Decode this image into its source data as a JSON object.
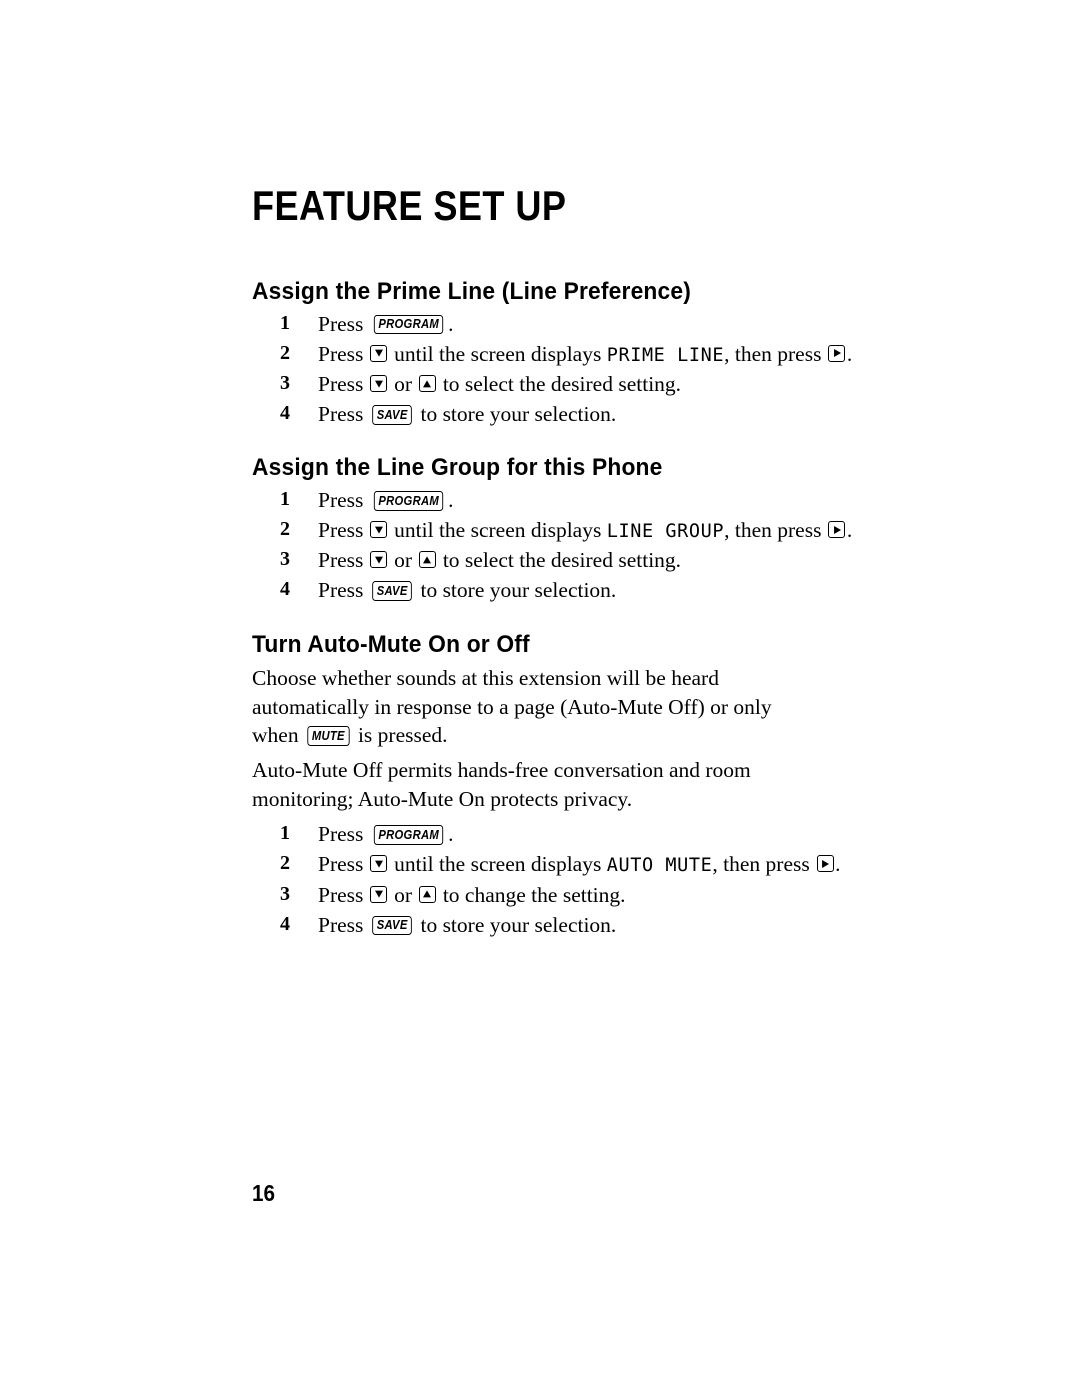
{
  "document": {
    "page_title": "FEATURE SET UP",
    "page_number": "16"
  },
  "keys": {
    "program": "PROGRAM",
    "save": "SAVE",
    "mute": "MUTE",
    "down_arrow": "down-arrow-key",
    "up_arrow": "up-arrow-key",
    "right_arrow": "right-arrow-key"
  },
  "sections": [
    {
      "heading": "Assign the Prime Line (Line Preference)",
      "steps": [
        {
          "num": "1",
          "parts": [
            {
              "t": "text",
              "v": "Press "
            },
            {
              "t": "key",
              "v": "PROGRAM"
            },
            {
              "t": "text",
              "v": "."
            }
          ]
        },
        {
          "num": "2",
          "parts": [
            {
              "t": "text",
              "v": "Press "
            },
            {
              "t": "arrow",
              "v": "down"
            },
            {
              "t": "text",
              "v": " until the screen displays "
            },
            {
              "t": "lcd",
              "v": "PRIME LINE"
            },
            {
              "t": "text",
              "v": ", then press "
            },
            {
              "t": "arrow",
              "v": "right"
            },
            {
              "t": "text",
              "v": "."
            }
          ]
        },
        {
          "num": "3",
          "parts": [
            {
              "t": "text",
              "v": "Press "
            },
            {
              "t": "arrow",
              "v": "down"
            },
            {
              "t": "text",
              "v": " or "
            },
            {
              "t": "arrow",
              "v": "up"
            },
            {
              "t": "text",
              "v": " to select the desired setting."
            }
          ]
        },
        {
          "num": "4",
          "parts": [
            {
              "t": "text",
              "v": "Press "
            },
            {
              "t": "key",
              "v": "SAVE"
            },
            {
              "t": "text",
              "v": " to store your selection."
            }
          ]
        }
      ]
    },
    {
      "heading": "Assign the Line Group for this Phone",
      "steps": [
        {
          "num": "1",
          "parts": [
            {
              "t": "text",
              "v": "Press "
            },
            {
              "t": "key",
              "v": "PROGRAM"
            },
            {
              "t": "text",
              "v": "."
            }
          ]
        },
        {
          "num": "2",
          "parts": [
            {
              "t": "text",
              "v": "Press "
            },
            {
              "t": "arrow",
              "v": "down"
            },
            {
              "t": "text",
              "v": " until the screen displays "
            },
            {
              "t": "lcd",
              "v": "LINE GROUP"
            },
            {
              "t": "text",
              "v": ", then press "
            },
            {
              "t": "arrow",
              "v": "right"
            },
            {
              "t": "text",
              "v": "."
            }
          ]
        },
        {
          "num": "3",
          "parts": [
            {
              "t": "text",
              "v": "Press "
            },
            {
              "t": "arrow",
              "v": "down"
            },
            {
              "t": "text",
              "v": " or "
            },
            {
              "t": "arrow",
              "v": "up"
            },
            {
              "t": "text",
              "v": " to select the desired setting."
            }
          ]
        },
        {
          "num": "4",
          "parts": [
            {
              "t": "text",
              "v": "Press "
            },
            {
              "t": "key",
              "v": "SAVE"
            },
            {
              "t": "text",
              "v": " to store your selection."
            }
          ]
        }
      ]
    },
    {
      "heading": "Turn Auto-Mute On or Off",
      "paragraphs": [
        [
          {
            "t": "text",
            "v": "Choose whether sounds at this extension will be heard automatically in response to a page (Auto-Mute Off) or only when "
          },
          {
            "t": "key",
            "v": "MUTE"
          },
          {
            "t": "text",
            "v": " is pressed."
          }
        ],
        [
          {
            "t": "text",
            "v": "Auto-Mute Off permits hands-free conversation and room monitoring; Auto-Mute On protects privacy."
          }
        ]
      ],
      "steps": [
        {
          "num": "1",
          "parts": [
            {
              "t": "text",
              "v": "Press "
            },
            {
              "t": "key",
              "v": "PROGRAM"
            },
            {
              "t": "text",
              "v": "."
            }
          ]
        },
        {
          "num": "2",
          "parts": [
            {
              "t": "text",
              "v": "Press "
            },
            {
              "t": "arrow",
              "v": "down"
            },
            {
              "t": "text",
              "v": " until the screen displays "
            },
            {
              "t": "lcd",
              "v": "AUTO MUTE"
            },
            {
              "t": "text",
              "v": ", then press "
            },
            {
              "t": "arrow",
              "v": "right"
            },
            {
              "t": "text",
              "v": "."
            }
          ]
        },
        {
          "num": "3",
          "parts": [
            {
              "t": "text",
              "v": "Press "
            },
            {
              "t": "arrow",
              "v": "down"
            },
            {
              "t": "text",
              "v": " or "
            },
            {
              "t": "arrow",
              "v": "up"
            },
            {
              "t": "text",
              "v": " to change the setting."
            }
          ]
        },
        {
          "num": "4",
          "parts": [
            {
              "t": "text",
              "v": "Press "
            },
            {
              "t": "key",
              "v": "SAVE"
            },
            {
              "t": "text",
              "v": " to store your selection."
            }
          ]
        }
      ]
    }
  ]
}
